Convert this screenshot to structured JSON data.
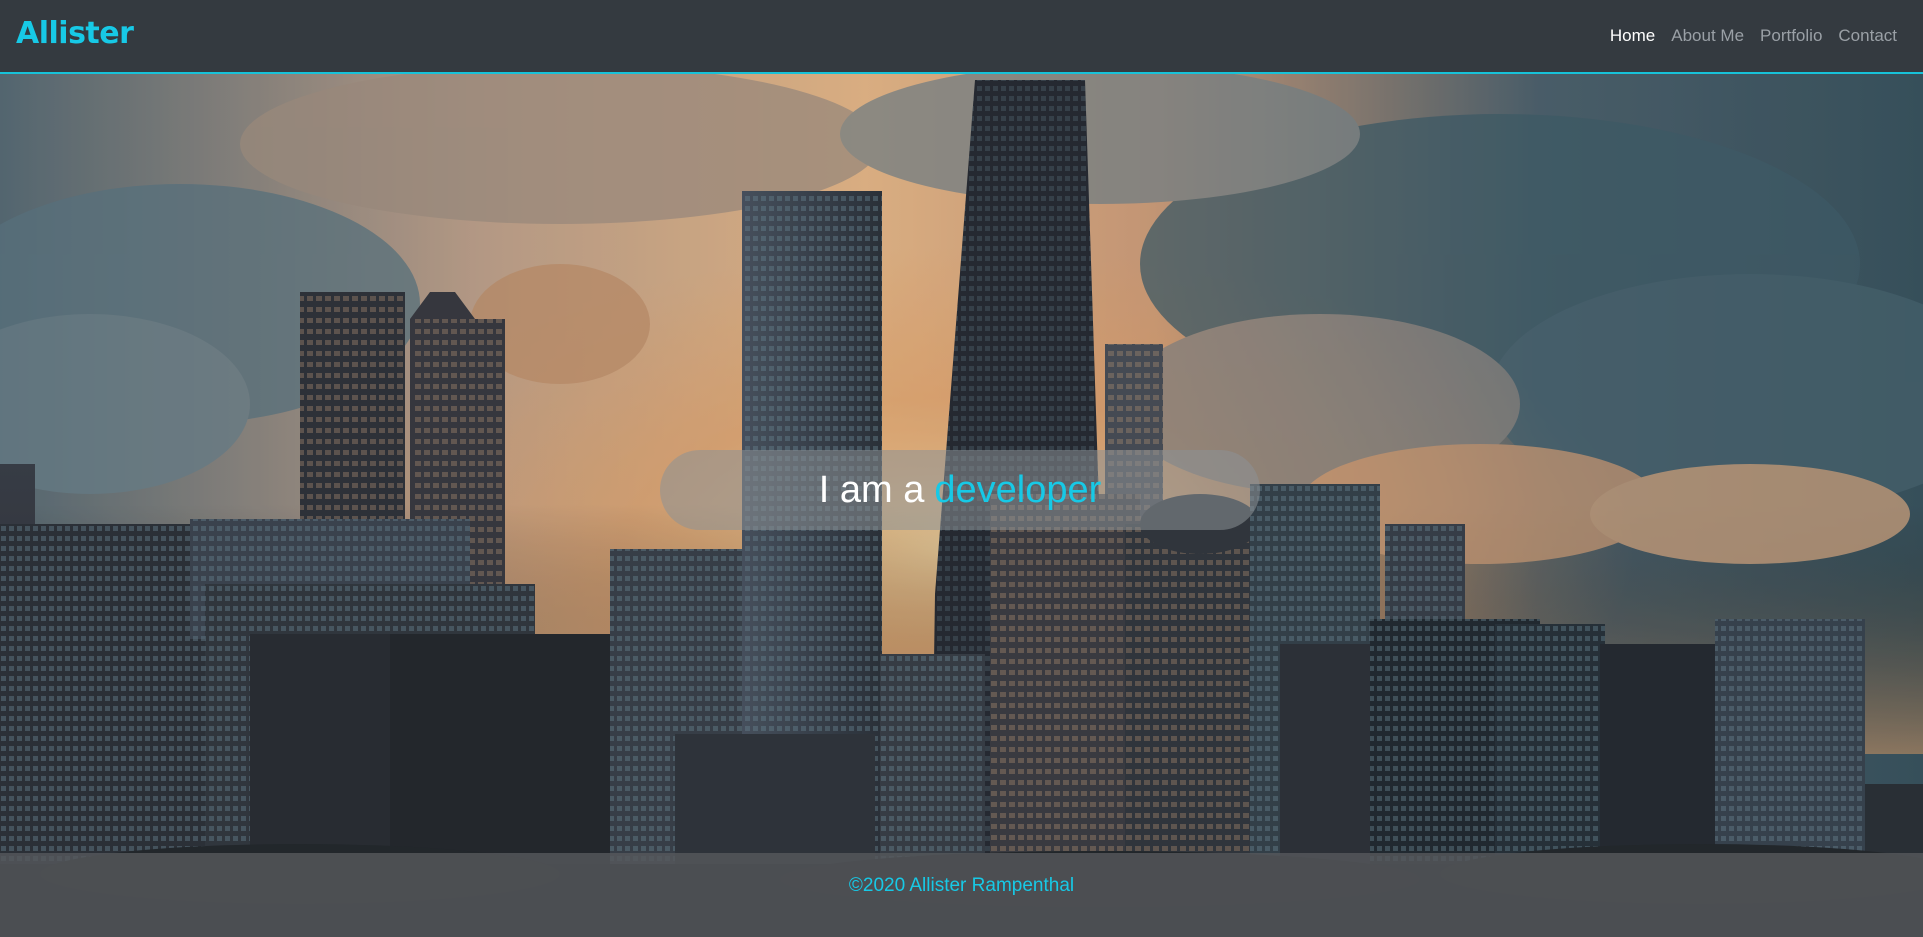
{
  "navbar": {
    "brand": "Allister",
    "links": [
      {
        "label": "Home",
        "active": true
      },
      {
        "label": "About Me",
        "active": false
      },
      {
        "label": "Portfolio",
        "active": false
      },
      {
        "label": "Contact",
        "active": false
      }
    ]
  },
  "hero": {
    "tagline_prefix": "I am a",
    "tagline_highlight": "developer"
  },
  "footer": {
    "copyright": "©2020 Allister Rampenthal"
  },
  "colors": {
    "accent": "#17c9e6",
    "navbar_bg": "#343a40"
  }
}
